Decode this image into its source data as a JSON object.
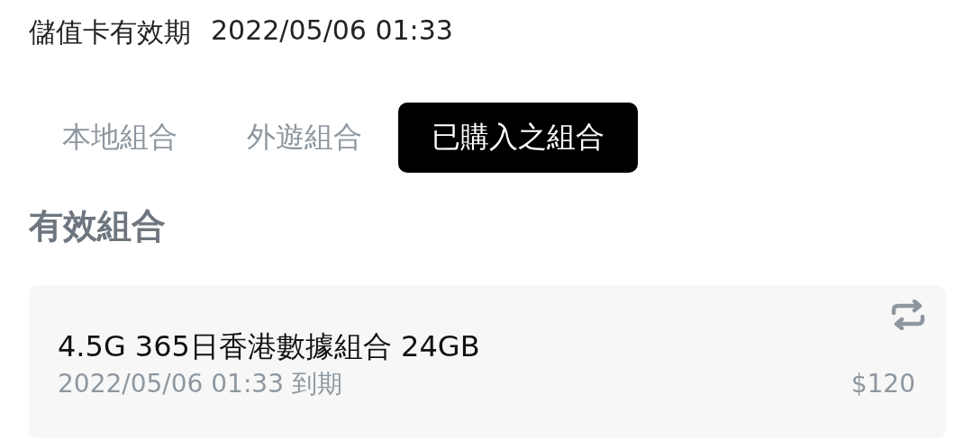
{
  "expiry": {
    "label": "儲值卡有效期",
    "value": "2022/05/06 01:33"
  },
  "tabs": [
    {
      "label": "本地組合",
      "selected": false
    },
    {
      "label": "外遊組合",
      "selected": false
    },
    {
      "label": "已購入之組合",
      "selected": true
    }
  ],
  "section_title": "有效組合",
  "plans": [
    {
      "name": "4.5G 365日香港數據組合 24GB",
      "expiry": "2022/05/06 01:33 到期",
      "price": "$120",
      "auto_renew": true
    }
  ]
}
